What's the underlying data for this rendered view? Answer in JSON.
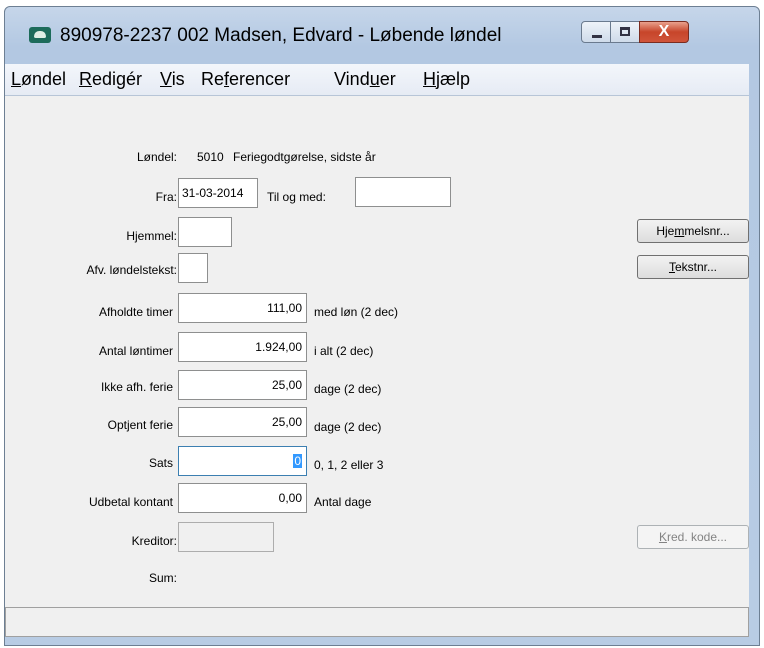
{
  "window": {
    "title": "890978-2237 002 Madsen, Edvard - Løbende løndel",
    "close_glyph": "X"
  },
  "menu": [
    {
      "prefix": "",
      "key": "L",
      "rest": "øndel"
    },
    {
      "prefix": "",
      "key": "R",
      "rest": "edigér"
    },
    {
      "prefix": "",
      "key": "V",
      "rest": "is"
    },
    {
      "prefix": "Re",
      "key": "f",
      "rest": "erencer"
    },
    {
      "prefix": "Vind",
      "key": "u",
      "rest": "er"
    },
    {
      "prefix": "",
      "key": "H",
      "rest": "jælp"
    }
  ],
  "form": {
    "loendel_label": "Løndel:",
    "loendel_code": "5010",
    "loendel_name": "Feriegodtgørelse, sidste år",
    "fra_label": "Fra:",
    "fra_value": "31-03-2014",
    "til_label": "Til og med:",
    "til_value": "",
    "hjemmel_label": "Hjemmel:",
    "hjemmel_value": "",
    "afv_label": "Afv. løndelstekst:",
    "afv_value": "",
    "afholdte_label": "Afholdte timer",
    "afholdte_value": "111,00",
    "afholdte_unit": "med løn (2 dec)",
    "antal_label": "Antal løntimer",
    "antal_value": "1.924,00",
    "antal_unit": "i alt (2 dec)",
    "ikke_label": "Ikke afh. ferie",
    "ikke_value": "25,00",
    "ikke_unit": "dage (2 dec)",
    "optjent_label": "Optjent ferie",
    "optjent_value": "25,00",
    "optjent_unit": "dage (2 dec)",
    "sats_label": "Sats",
    "sats_value": "0",
    "sats_unit": "0, 1, 2 eller 3",
    "udbetal_label": "Udbetal kontant",
    "udbetal_value": "0,00",
    "udbetal_unit": "Antal dage",
    "kreditor_label": "Kreditor:",
    "kreditor_value": "",
    "sum_label": "Sum:"
  },
  "buttons": {
    "hjemmelsnr": {
      "prefix": "Hje",
      "key": "m",
      "rest": "melsnr..."
    },
    "tekstnr": {
      "prefix": "",
      "key": "T",
      "rest": "ekstnr..."
    },
    "kred_kode": {
      "prefix": "",
      "key": "K",
      "rest": "red. kode..."
    }
  },
  "colors": {
    "selection": "#3399ff",
    "close_button": "#c7452a",
    "app_icon": "#1d6b5a"
  }
}
